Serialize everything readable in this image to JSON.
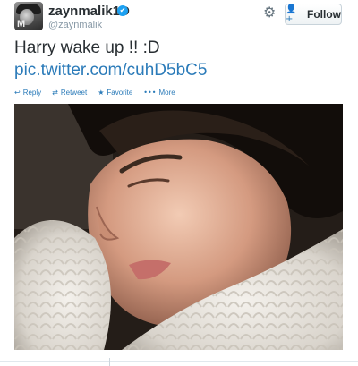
{
  "user": {
    "name": "zaynmalik1D",
    "handle": "@zaynmalik",
    "verified_icon": "✔",
    "avatar_letter": "M"
  },
  "header": {
    "settings_icon": "⚙",
    "follow_icon": "👤+",
    "follow_label": "Follow"
  },
  "tweet": {
    "text": "Harry wake up !! :D",
    "link": "pic.twitter.com/cuhD5bC5"
  },
  "actions": [
    {
      "icon": "↩",
      "label": "Reply"
    },
    {
      "icon": "⇄",
      "label": "Retweet"
    },
    {
      "icon": "★",
      "label": "Favorite"
    },
    {
      "icon": "•••",
      "label": "More"
    }
  ],
  "colors": {
    "link": "#2b7bb9",
    "verified": "#1da1f2",
    "text": "#292f33",
    "muted": "#8899a6"
  }
}
